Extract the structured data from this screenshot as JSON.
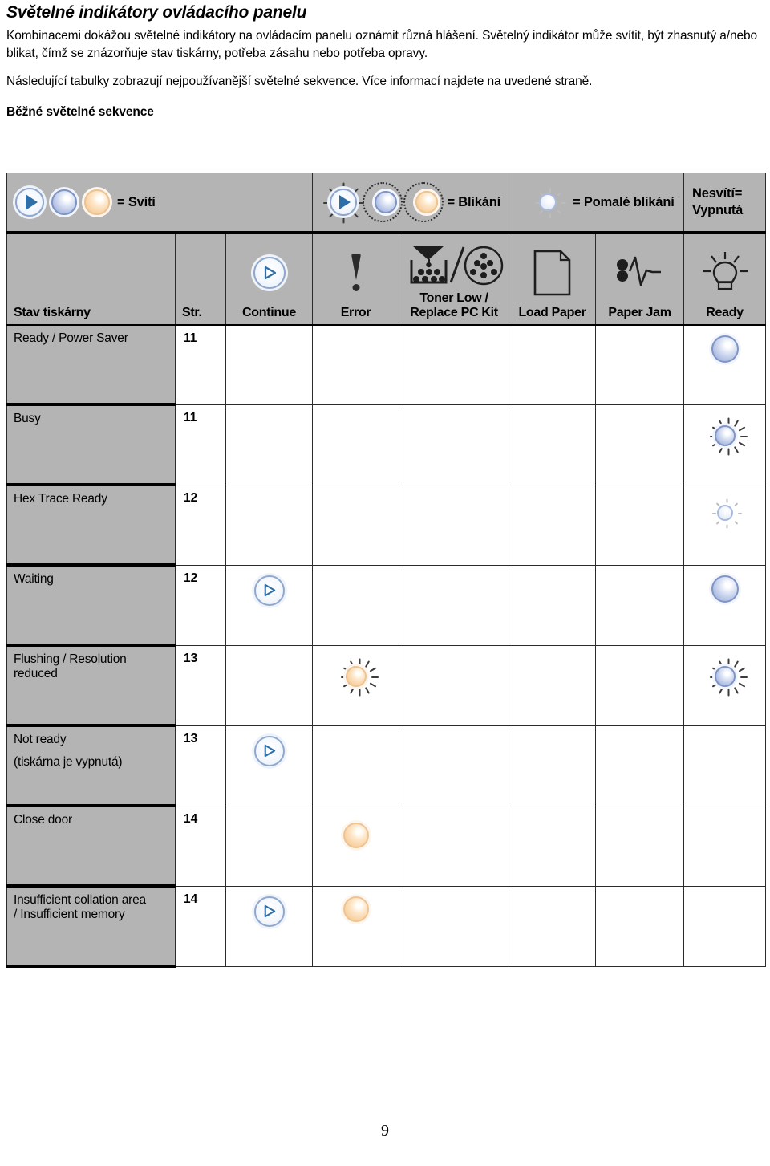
{
  "document": {
    "title": "Světelné indikátory ovládacího panelu",
    "paragraph_1": "Kombinacemi dokážou světelné indikátory na ovládacím panelu oznámit různá hlášení. Světelný indikátor může svítit, být zhasnutý a/nebo blikat, čímž se znázorňuje stav tiskárny, potřeba zásahu nebo potřeba opravy.",
    "paragraph_2": "Následující tabulky zobrazují nejpoužívanější světelné sekvence. Více informací najdete na uvedené straně.",
    "subheading": "Běžné světelné sekvence",
    "page_number": "9"
  },
  "legend": {
    "items": [
      {
        "id": "on",
        "label": "= Svítí",
        "icons": [
          "play-on-icon",
          "lamp-blue-on-icon",
          "lamp-orange-on-icon"
        ]
      },
      {
        "id": "blinking",
        "label": "= Blikání",
        "icons": [
          "play-blinking-icon",
          "lamp-blue-blinking-icon",
          "lamp-orange-blinking-icon"
        ]
      },
      {
        "id": "slow-blinking",
        "label": "= Pomalé blikání",
        "icons": [
          "lamp-blue-slow-blinking-icon"
        ]
      },
      {
        "id": "off",
        "label": "Nesvítí= Vypnutá",
        "label_line1": "Nesvítí=",
        "label_line2": "Vypnutá",
        "icons": []
      }
    ]
  },
  "table": {
    "columns": [
      {
        "key": "state",
        "label": "Stav tiskárny",
        "icon": null
      },
      {
        "key": "page",
        "label": "Str.",
        "icon": null
      },
      {
        "key": "continue",
        "label": "Continue",
        "icon": "continue-button-icon"
      },
      {
        "key": "error",
        "label": "Error",
        "icon": "error-exclamation-icon"
      },
      {
        "key": "toner",
        "label": "Toner Low / Replace PC Kit",
        "label_line1": "Toner Low /",
        "label_line2": "Replace PC Kit",
        "icon": "toner-low-icon"
      },
      {
        "key": "load_paper",
        "label": "Load Paper",
        "icon": "paper-sheet-icon"
      },
      {
        "key": "paper_jam",
        "label": "Paper Jam",
        "icon": "paper-jam-icon"
      },
      {
        "key": "ready",
        "label": "Ready",
        "icon": "lightbulb-icon"
      }
    ],
    "rows": [
      {
        "state_lines": [
          "Ready / Power Saver"
        ],
        "page": "11",
        "continue": null,
        "error": null,
        "toner": null,
        "load_paper": null,
        "paper_jam": null,
        "ready": "lamp-blue-on-icon"
      },
      {
        "state_lines": [
          "Busy"
        ],
        "page": "11",
        "continue": null,
        "error": null,
        "toner": null,
        "load_paper": null,
        "paper_jam": null,
        "ready": "lamp-blue-blinking-icon"
      },
      {
        "state_lines": [
          "Hex Trace Ready"
        ],
        "page": "12",
        "continue": null,
        "error": null,
        "toner": null,
        "load_paper": null,
        "paper_jam": null,
        "ready": "lamp-blue-slow-blinking-icon"
      },
      {
        "state_lines": [
          "Waiting"
        ],
        "page": "12",
        "continue": "play-on-icon",
        "error": null,
        "toner": null,
        "load_paper": null,
        "paper_jam": null,
        "ready": "lamp-blue-on-icon"
      },
      {
        "state_lines": [
          "Flushing / Resolution",
          "reduced"
        ],
        "page": "13",
        "continue": null,
        "error": "lamp-orange-blinking-icon",
        "toner": null,
        "load_paper": null,
        "paper_jam": null,
        "ready": "lamp-blue-blinking-icon"
      },
      {
        "state_lines": [
          "Not ready",
          "(tiskárna je vypnutá)"
        ],
        "page": "13",
        "continue": "play-on-icon",
        "error": null,
        "toner": null,
        "load_paper": null,
        "paper_jam": null,
        "ready": null
      },
      {
        "state_lines": [
          "Close door"
        ],
        "page": "14",
        "continue": null,
        "error": "lamp-orange-on-icon",
        "toner": null,
        "load_paper": null,
        "paper_jam": null,
        "ready": null
      },
      {
        "state_lines": [
          "Insufficient collation area",
          "/ Insufficient memory"
        ],
        "page": "14",
        "continue": "play-on-icon",
        "error": "lamp-orange-on-icon",
        "toner": null,
        "load_paper": null,
        "paper_jam": null,
        "ready": null
      }
    ]
  },
  "colors": {
    "header_fill": "#b4b4b4",
    "led_blue": "#8fa3d3",
    "led_orange": "#f2c68f",
    "play_accent": "#2f6fa8",
    "rule": "#2b2b2b"
  }
}
